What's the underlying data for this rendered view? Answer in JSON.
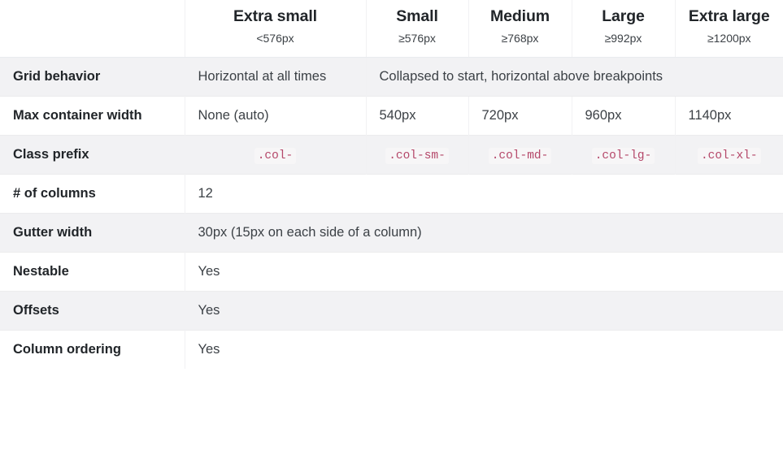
{
  "table": {
    "corner_label": "",
    "breakpoints": [
      {
        "title": "Extra small",
        "sub": "<576px"
      },
      {
        "title": "Small",
        "sub": "≥576px"
      },
      {
        "title": "Medium",
        "sub": "≥768px"
      },
      {
        "title": "Large",
        "sub": "≥992px"
      },
      {
        "title": "Extra large",
        "sub": "≥1200px"
      }
    ],
    "rows": [
      {
        "label": "Grid behavior",
        "cells": [
          {
            "text": "Horizontal at all times",
            "span": 1
          },
          {
            "text": "Collapsed to start, horizontal above breakpoints",
            "span": 4
          }
        ]
      },
      {
        "label": "Max container width",
        "cells": [
          {
            "text": "None (auto)",
            "span": 1
          },
          {
            "text": "540px",
            "span": 1
          },
          {
            "text": "720px",
            "span": 1
          },
          {
            "text": "960px",
            "span": 1
          },
          {
            "text": "1140px",
            "span": 1
          }
        ]
      },
      {
        "label": "Class prefix",
        "cells": [
          {
            "text": ".col-",
            "span": 1,
            "code": true
          },
          {
            "text": ".col-sm-",
            "span": 1,
            "code": true
          },
          {
            "text": ".col-md-",
            "span": 1,
            "code": true
          },
          {
            "text": ".col-lg-",
            "span": 1,
            "code": true
          },
          {
            "text": ".col-xl-",
            "span": 1,
            "code": true
          }
        ]
      },
      {
        "label": "# of columns",
        "cells": [
          {
            "text": "12",
            "span": 5
          }
        ]
      },
      {
        "label": "Gutter width",
        "cells": [
          {
            "text": "30px (15px on each side of a column)",
            "span": 5
          }
        ]
      },
      {
        "label": "Nestable",
        "cells": [
          {
            "text": "Yes",
            "span": 5
          }
        ]
      },
      {
        "label": "Offsets",
        "cells": [
          {
            "text": "Yes",
            "span": 5
          }
        ]
      },
      {
        "label": "Column ordering",
        "cells": [
          {
            "text": "Yes",
            "span": 5
          }
        ]
      }
    ]
  },
  "colors": {
    "stripe": "#f2f2f4",
    "border": "#ececed",
    "code_text": "#b5486a",
    "code_bg": "#f7f6f7",
    "heading_text": "#212529",
    "body_text": "#3c4146"
  }
}
